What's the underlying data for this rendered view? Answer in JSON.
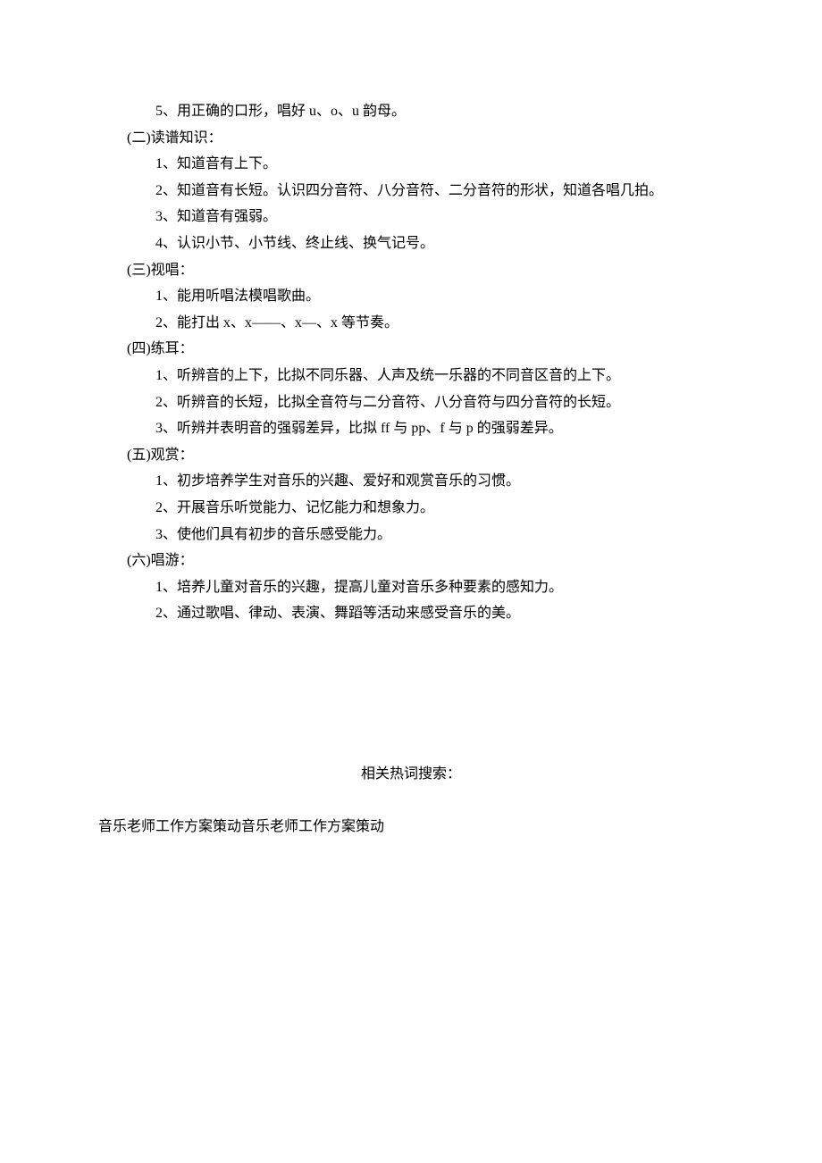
{
  "lines": {
    "l1": "5、用正确的口形，唱好 u、o、u 韵母。",
    "l2": "(二)读谱知识：",
    "l3": "1、知道音有上下。",
    "l4": "2、知道音有长短。认识四分音符、八分音符、二分音符的形状，知道各唱几拍。",
    "l5": "3、知道音有强弱。",
    "l6": "4、认识小节、小节线、终止线、换气记号。",
    "l7": "(三)视唱：",
    "l8": "1、能用听唱法模唱歌曲。",
    "l9": "2、能打出 x、x——、x—、x 等节奏。",
    "l10": "(四)练耳：",
    "l11": "1、听辨音的上下，比拟不同乐器、人声及统一乐器的不同音区音的上下。",
    "l12": "2、听辨音的长短，比拟全音符与二分音符、八分音符与四分音符的长短。",
    "l13": "3、听辨并表明音的强弱差异，比拟 ff 与 pp、f 与 p 的强弱差异。",
    "l14": "(五)观赏：",
    "l15": "1、初步培养学生对音乐的兴趣、爱好和观赏音乐的习惯。",
    "l16": "2、开展音乐听觉能力、记忆能力和想象力。",
    "l17": "3、使他们具有初步的音乐感受能力。",
    "l18": "(六)唱游：",
    "l19": "1、培养儿童对音乐的兴趣，提高儿童对音乐多种要素的感知力。",
    "l20": "2、通过歌唱、律动、表演、舞蹈等活动来感受音乐的美。",
    "l21": "相关热词搜索：",
    "l22": "音乐老师工作方案策动音乐老师工作方案策动"
  }
}
